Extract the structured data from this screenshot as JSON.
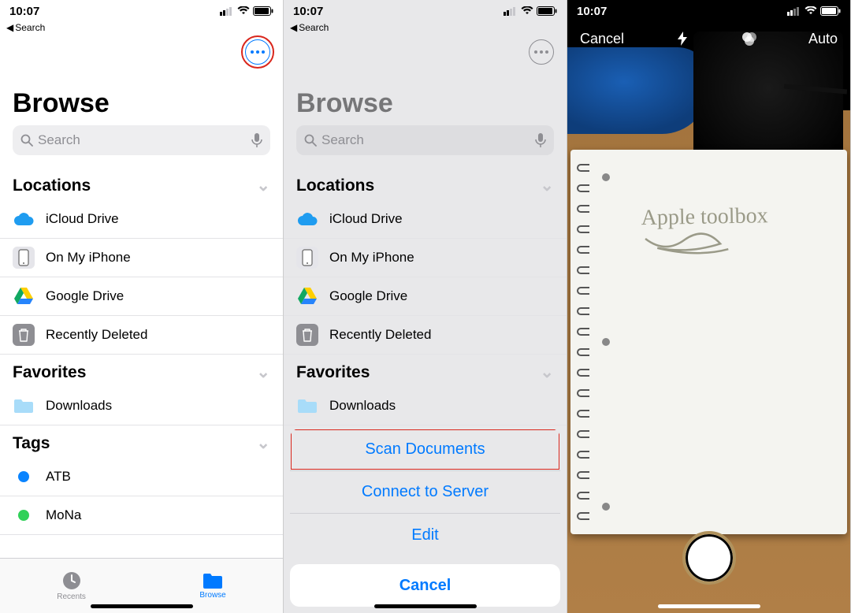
{
  "status": {
    "time": "10:07"
  },
  "back": {
    "label": "Search"
  },
  "title": "Browse",
  "search": {
    "placeholder": "Search"
  },
  "sections": {
    "locations": {
      "header": "Locations",
      "items": [
        {
          "label": "iCloud Drive"
        },
        {
          "label": "On My iPhone"
        },
        {
          "label": "Google Drive"
        },
        {
          "label": "Recently Deleted"
        }
      ]
    },
    "favorites": {
      "header": "Favorites",
      "items": [
        {
          "label": "Downloads"
        }
      ]
    },
    "tags": {
      "header": "Tags",
      "items": [
        {
          "label": "ATB",
          "color": "#0a84ff"
        },
        {
          "label": "MoNa",
          "color": "#30d158"
        }
      ]
    }
  },
  "tabs": {
    "recents": "Recents",
    "browse": "Browse"
  },
  "sheet": {
    "scan": "Scan Documents",
    "connect": "Connect to Server",
    "edit": "Edit",
    "cancel": "Cancel"
  },
  "camera": {
    "cancel": "Cancel",
    "auto": "Auto",
    "note_text": "Apple toolbox"
  }
}
